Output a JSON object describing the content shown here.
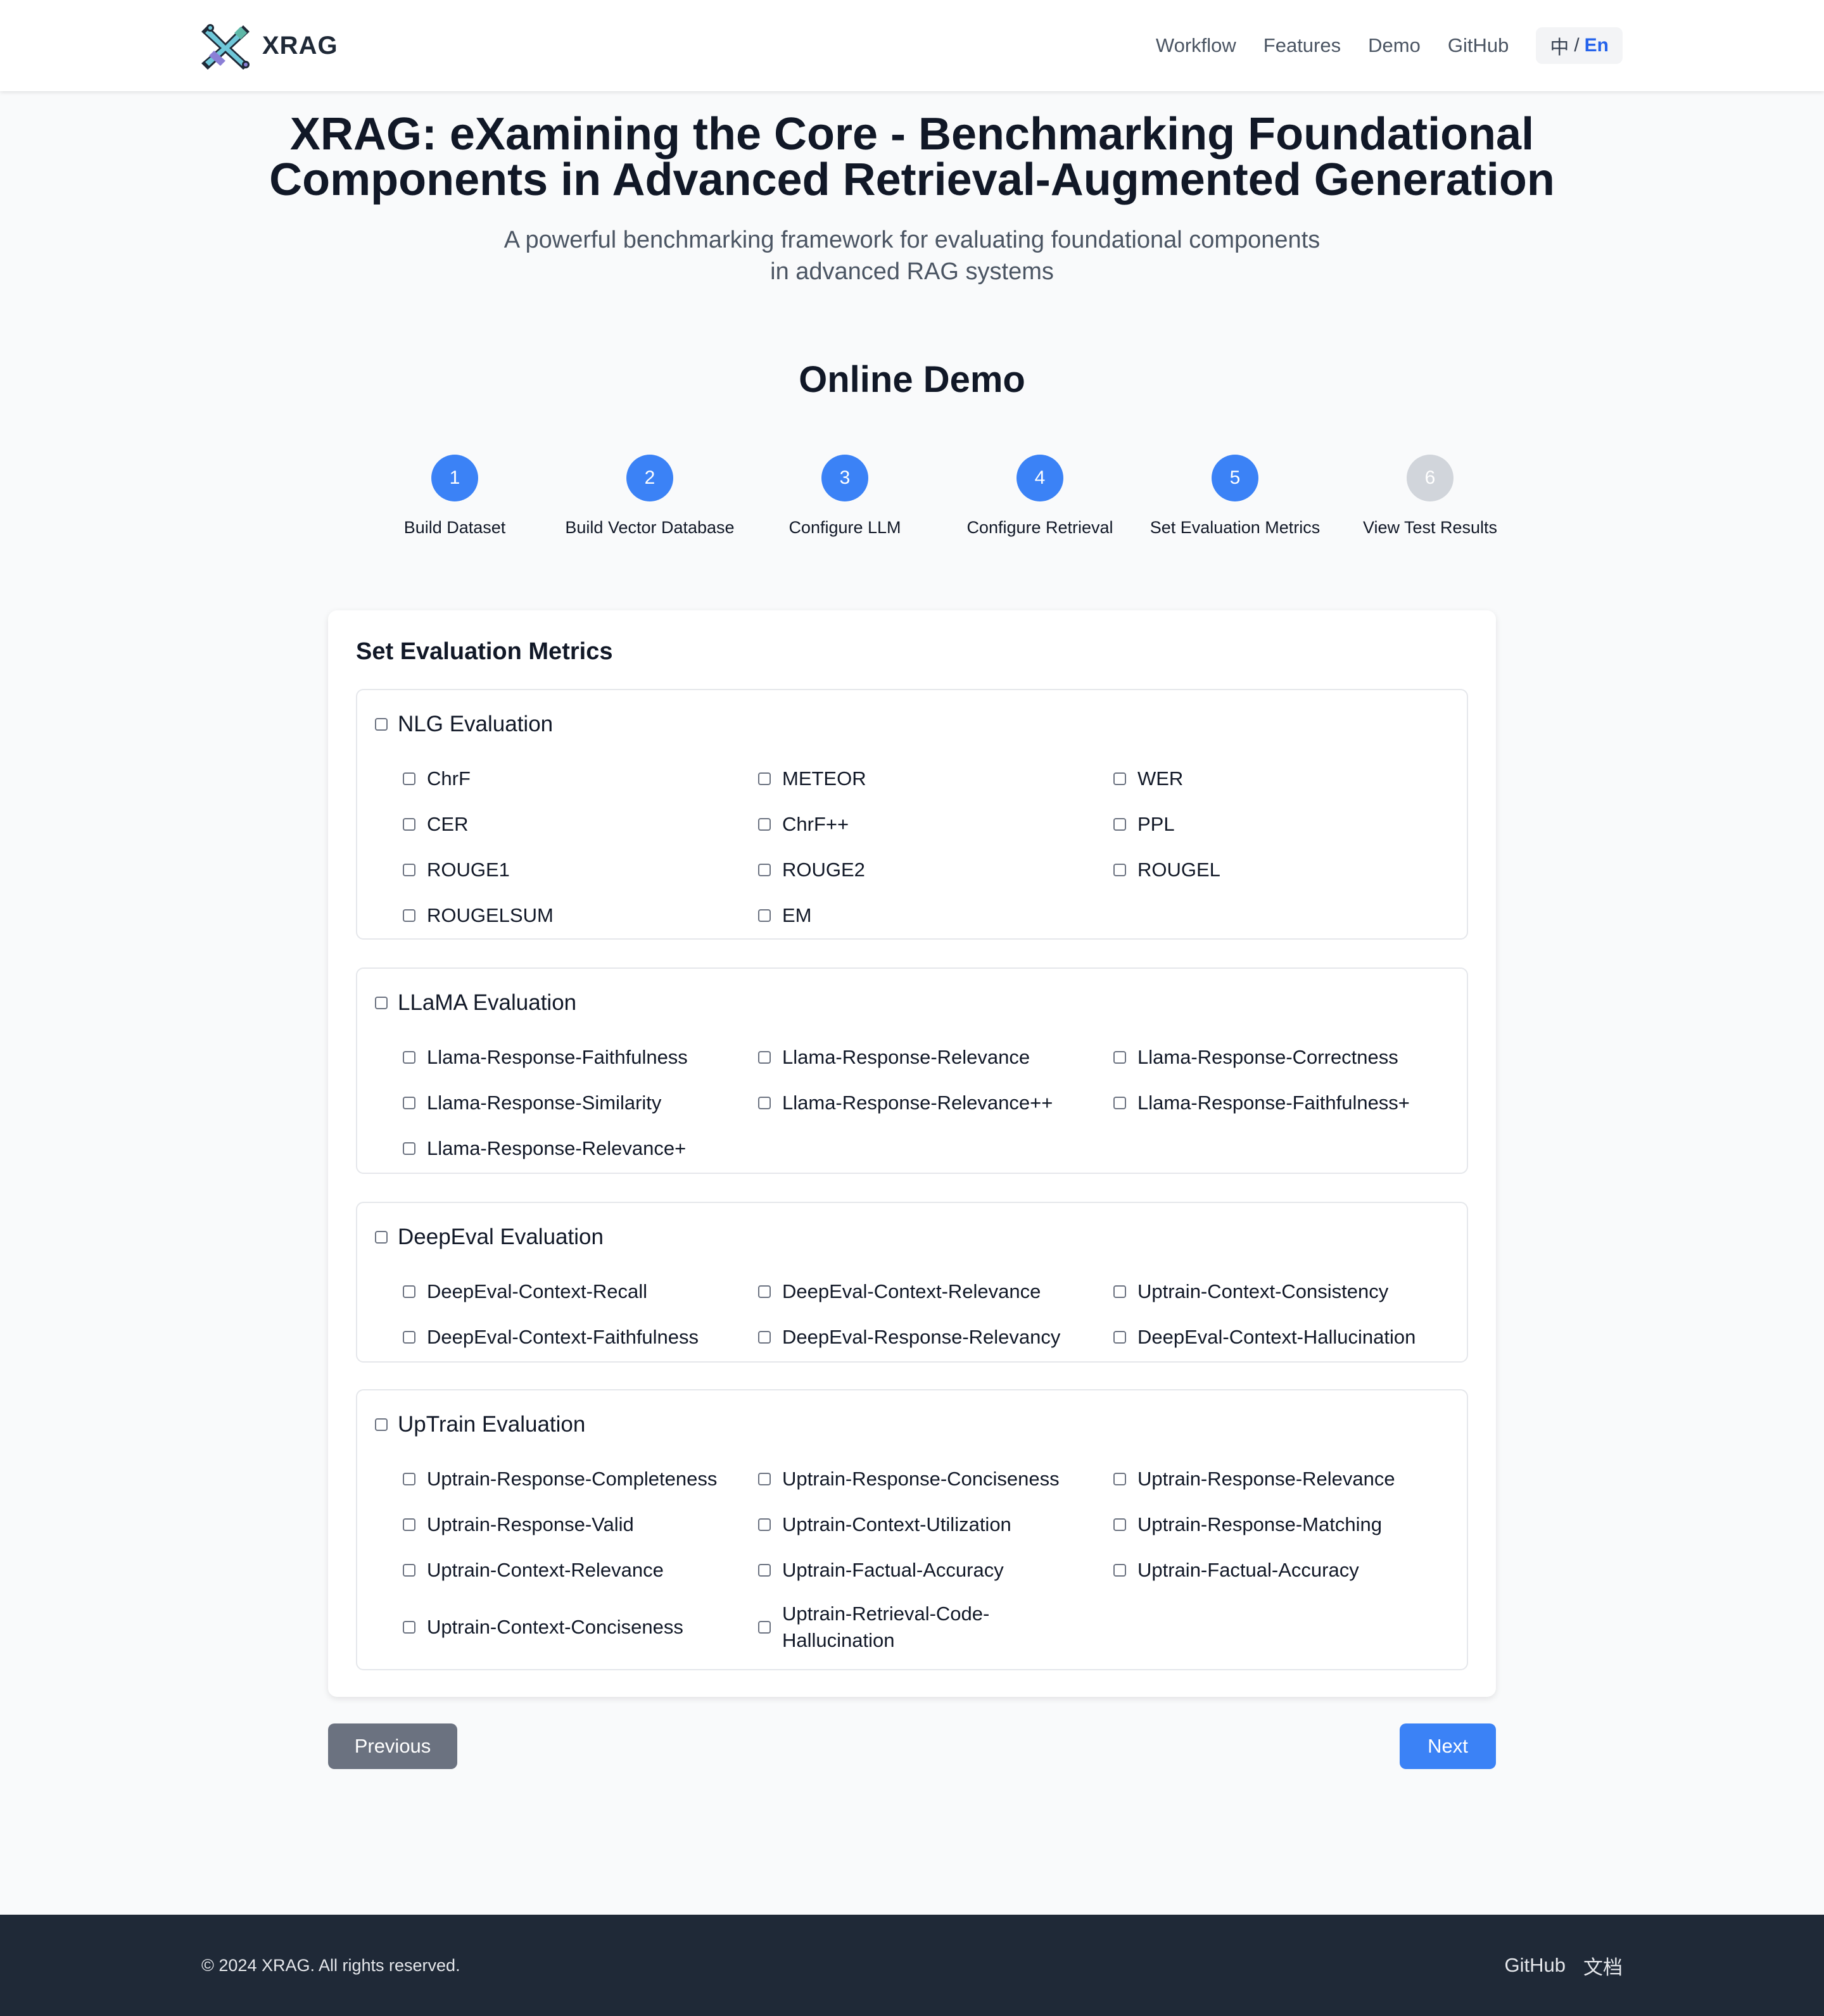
{
  "brand": {
    "name": "XRAG",
    "logo_icon": "x-logo-icon"
  },
  "nav": {
    "links": [
      "Workflow",
      "Features",
      "Demo",
      "GitHub"
    ],
    "lang_zh": "中",
    "lang_sep": "/",
    "lang_en": "En"
  },
  "hero": {
    "title_line1": "XRAG: eXamining the Core - Benchmarking Foundational",
    "title_line2": "Components in Advanced Retrieval-Augmented Generation",
    "subtitle_line1": "A powerful benchmarking framework for evaluating foundational components",
    "subtitle_line2": "in advanced RAG systems"
  },
  "demo": {
    "heading": "Online Demo",
    "steps": [
      {
        "number": "1",
        "label": "Build Dataset",
        "active": true
      },
      {
        "number": "2",
        "label": "Build Vector Database",
        "active": true
      },
      {
        "number": "3",
        "label": "Configure LLM",
        "active": true
      },
      {
        "number": "4",
        "label": "Configure Retrieval",
        "active": true
      },
      {
        "number": "5",
        "label": "Set Evaluation Metrics",
        "active": true
      },
      {
        "number": "6",
        "label": "View Test Results",
        "active": false
      }
    ]
  },
  "metrics": {
    "title": "Set Evaluation Metrics",
    "groups": [
      {
        "name": "NLG Evaluation",
        "items": [
          "ChrF",
          "METEOR",
          "WER",
          "CER",
          "ChrF++",
          "PPL",
          "ROUGE1",
          "ROUGE2",
          "ROUGEL",
          "ROUGELSUM",
          "EM"
        ]
      },
      {
        "name": "LLaMA Evaluation",
        "items": [
          "Llama-Response-Faithfulness",
          "Llama-Response-Relevance",
          "Llama-Response-Correctness",
          "Llama-Response-Similarity",
          "Llama-Response-Relevance++",
          "Llama-Response-Faithfulness+",
          "Llama-Response-Relevance+"
        ]
      },
      {
        "name": "DeepEval Evaluation",
        "items": [
          "DeepEval-Context-Recall",
          "DeepEval-Context-Relevance",
          "Uptrain-Context-Consistency",
          "DeepEval-Context-Faithfulness",
          "DeepEval-Response-Relevancy",
          "DeepEval-Context-Hallucination"
        ]
      },
      {
        "name": "UpTrain Evaluation",
        "items": [
          "Uptrain-Response-Completeness",
          "Uptrain-Response-Conciseness",
          "Uptrain-Response-Relevance",
          "Uptrain-Response-Valid",
          "Uptrain-Context-Utilization",
          "Uptrain-Response-Matching",
          "Uptrain-Context-Relevance",
          "Uptrain-Factual-Accuracy",
          "Uptrain-Factual-Accuracy",
          "Uptrain-Context-Conciseness",
          "Uptrain-Retrieval-Code-Hallucination"
        ]
      }
    ]
  },
  "buttons": {
    "previous": "Previous",
    "next": "Next"
  },
  "footer": {
    "copyright": "© 2024 XRAG. All rights reserved.",
    "links": [
      "GitHub",
      "文档"
    ]
  },
  "colors": {
    "accent": "#3b82f6",
    "inactive_step": "#d1d5db",
    "secondary_button": "#6b7280",
    "footer_bg": "#1f2937"
  }
}
